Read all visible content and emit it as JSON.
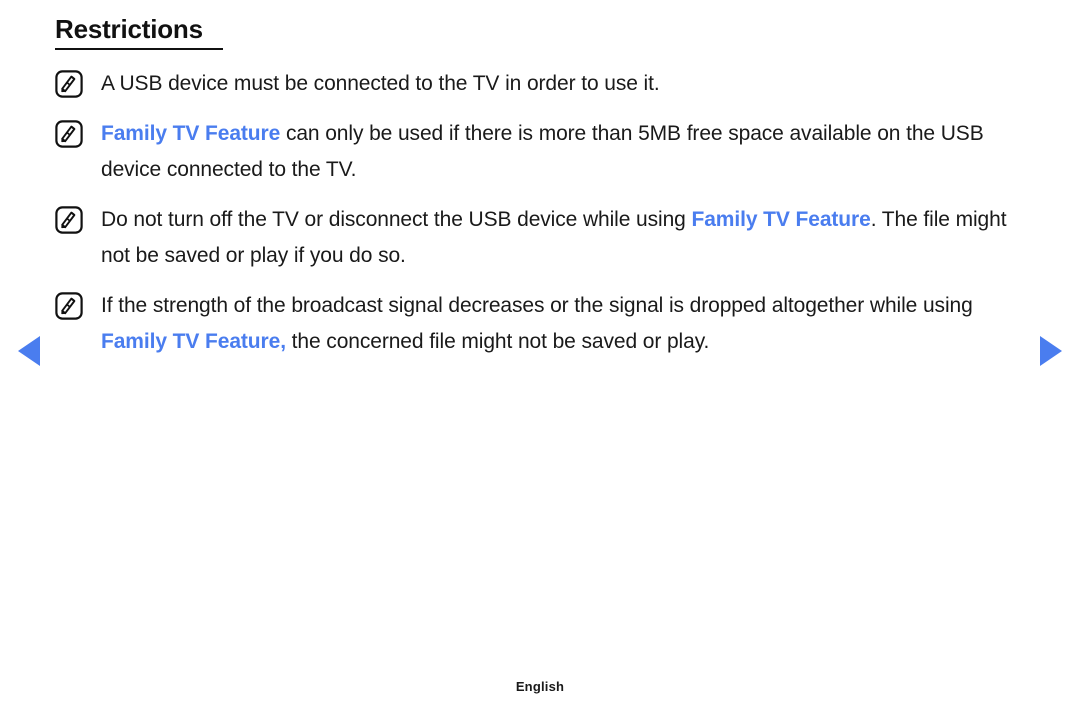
{
  "page": {
    "title": "Restrictions",
    "accent_color": "#4a7def",
    "text_color": "#1a1a1a",
    "background_color": "#ffffff",
    "footer_language": "English"
  },
  "bullets": [
    {
      "icon": "note-pen-icon",
      "segments": [
        {
          "text": "A USB device must be connected to the TV in order to use it.",
          "style": "normal"
        }
      ]
    },
    {
      "icon": "note-pen-icon",
      "segments": [
        {
          "text": "Family TV Feature",
          "style": "highlight"
        },
        {
          "text": " can only be used if there is more than 5MB free space available on the USB device connected to the TV.",
          "style": "normal"
        }
      ]
    },
    {
      "icon": "note-pen-icon",
      "segments": [
        {
          "text": "Do not turn off the TV or disconnect the USB device while using ",
          "style": "normal"
        },
        {
          "text": "Family TV Feature",
          "style": "highlight"
        },
        {
          "text": ". The file might not be saved or play if you do so.",
          "style": "normal"
        }
      ]
    },
    {
      "icon": "note-pen-icon",
      "segments": [
        {
          "text": "If the strength of the broadcast signal decreases or the signal is dropped altogether while using ",
          "style": "normal"
        },
        {
          "text": "Family TV Feature,",
          "style": "highlight"
        },
        {
          "text": " the concerned file might not be saved or play.",
          "style": "normal"
        }
      ]
    }
  ],
  "nav": {
    "prev_label": "previous-page",
    "next_label": "next-page"
  }
}
